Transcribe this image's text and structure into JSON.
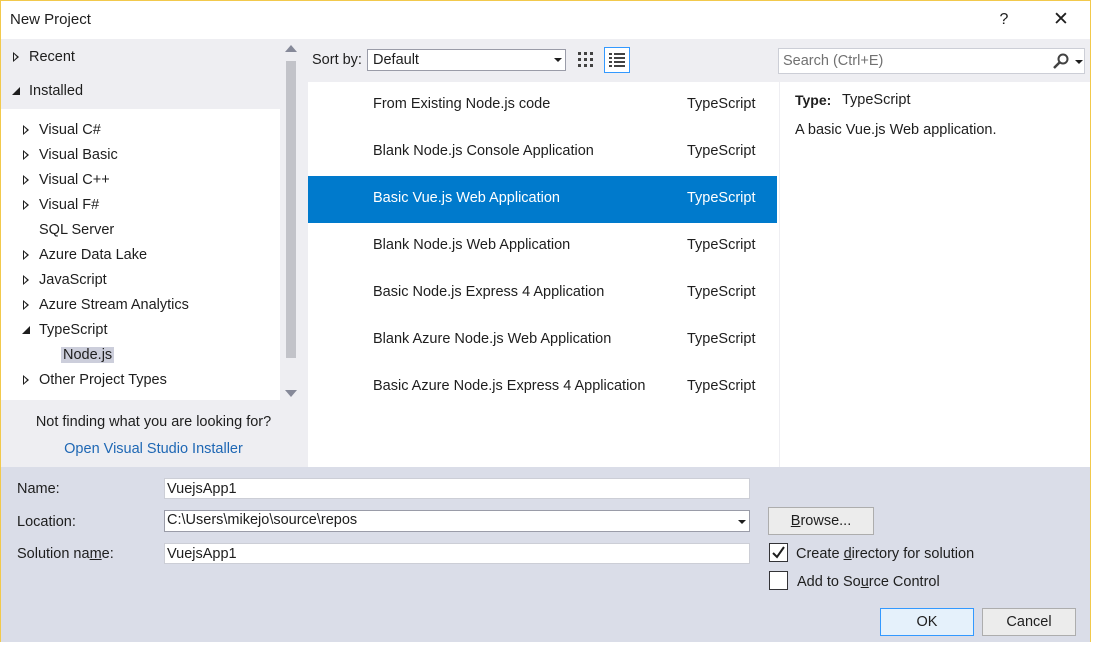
{
  "window": {
    "title": "New Project",
    "help_glyph": "?",
    "close_glyph": "✕"
  },
  "left": {
    "top_items": [
      {
        "label": "Recent",
        "state": "collapsed"
      },
      {
        "label": "Installed",
        "state": "expanded"
      }
    ],
    "tree": [
      {
        "label": "Visual C#",
        "state": "collapsed"
      },
      {
        "label": "Visual Basic",
        "state": "collapsed"
      },
      {
        "label": "Visual C++",
        "state": "collapsed"
      },
      {
        "label": "Visual F#",
        "state": "collapsed"
      },
      {
        "label": "SQL Server",
        "state": "none"
      },
      {
        "label": "Azure Data Lake",
        "state": "collapsed"
      },
      {
        "label": "JavaScript",
        "state": "collapsed"
      },
      {
        "label": "Azure Stream Analytics",
        "state": "collapsed"
      },
      {
        "label": "TypeScript",
        "state": "expanded"
      },
      {
        "label": "Node.js",
        "state": "selected"
      },
      {
        "label": "Other Project Types",
        "state": "collapsed"
      }
    ],
    "not_finding": "Not finding what you are looking for?",
    "installer_link": "Open Visual Studio Installer"
  },
  "toolbar": {
    "sort_label": "Sort by:",
    "sort_value": "Default",
    "search_placeholder": "Search (Ctrl+E)"
  },
  "templates": [
    {
      "name": "From Existing Node.js code",
      "lang": "TypeScript"
    },
    {
      "name": "Blank Node.js Console Application",
      "lang": "TypeScript"
    },
    {
      "name": "Basic Vue.js Web Application",
      "lang": "TypeScript",
      "selected": true
    },
    {
      "name": "Blank Node.js Web Application",
      "lang": "TypeScript"
    },
    {
      "name": "Basic Node.js Express 4 Application",
      "lang": "TypeScript"
    },
    {
      "name": "Blank Azure Node.js Web Application",
      "lang": "TypeScript"
    },
    {
      "name": "Basic Azure Node.js Express 4 Application",
      "lang": "TypeScript"
    }
  ],
  "description": {
    "type_label": "Type:",
    "type_value": "TypeScript",
    "text": "A basic Vue.js Web application."
  },
  "form": {
    "name_label": "Name:",
    "name_value": "VuejsApp1",
    "location_label": "Location:",
    "location_value": "C:\\Users\\mikejo\\source\\repos",
    "solution_label_a": "Solution na",
    "solution_label_u": "m",
    "solution_label_b": "e:",
    "solution_value": "VuejsApp1",
    "browse_label_u": "B",
    "browse_label_rest": "rowse...",
    "create_dir_a": "Create ",
    "create_dir_u": "d",
    "create_dir_b": "irectory for solution",
    "create_dir_checked": true,
    "source_ctrl_a": "Add to So",
    "source_ctrl_u": "u",
    "source_ctrl_b": "rce Control",
    "source_ctrl_checked": false,
    "ok_label": "OK",
    "cancel_label": "Cancel"
  },
  "colors": {
    "accent": "#007acc",
    "link": "#1e67b4",
    "panel_bg": "#eeeef2",
    "form_bg": "#dadde8"
  }
}
